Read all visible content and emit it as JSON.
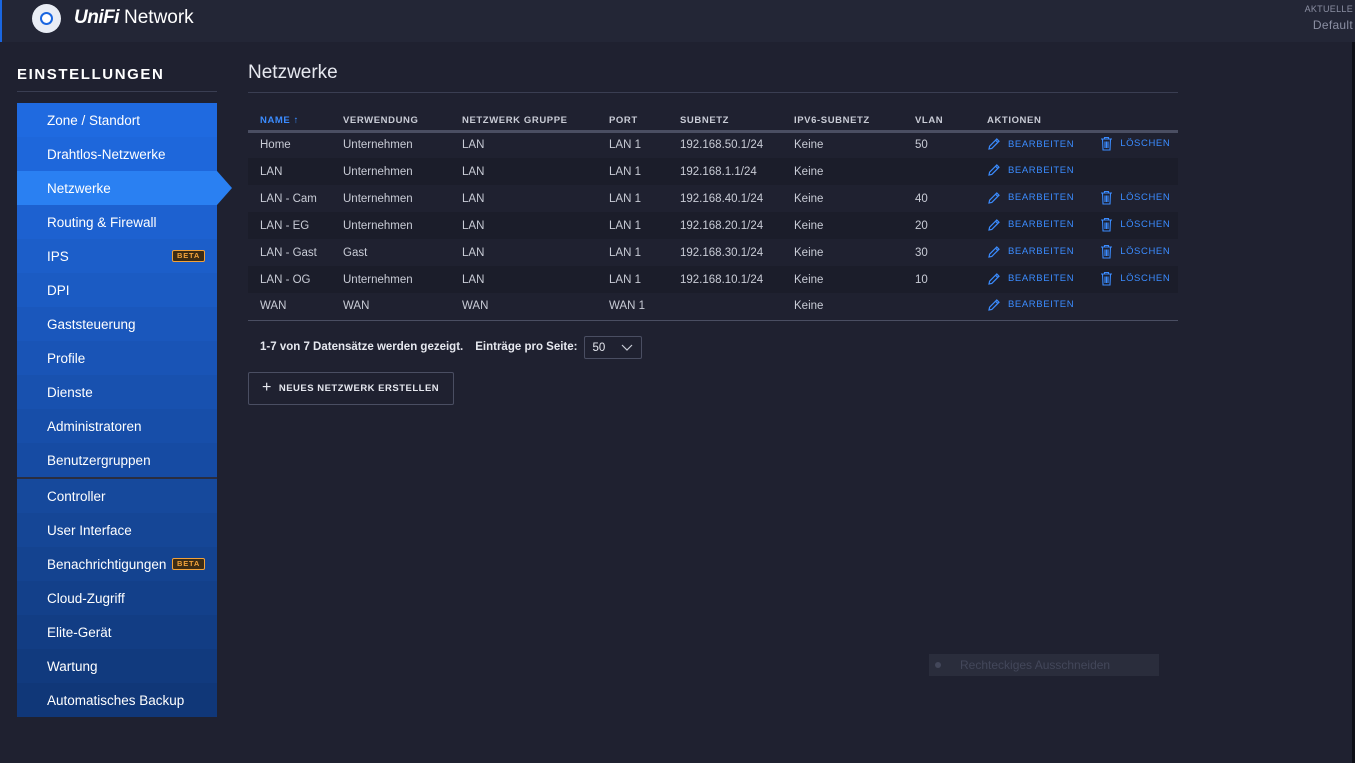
{
  "app": {
    "brand_strong": "UniFi",
    "brand_rest": "Network",
    "site_label": "AKTUELLE",
    "site_name": "Default"
  },
  "sidebar": {
    "title": "EINSTELLUNGEN",
    "items": [
      {
        "label": "Zone / Standort"
      },
      {
        "label": "Drahtlos-Netzwerke"
      },
      {
        "label": "Netzwerke",
        "active": true
      },
      {
        "label": "Routing & Firewall"
      },
      {
        "label": "IPS",
        "badge": "BETA"
      },
      {
        "label": "DPI"
      },
      {
        "label": "Gaststeuerung"
      },
      {
        "label": "Profile"
      },
      {
        "label": "Dienste"
      },
      {
        "label": "Administratoren"
      },
      {
        "label": "Benutzergruppen"
      },
      {
        "label": "Controller"
      },
      {
        "label": "User Interface"
      },
      {
        "label": "Benachrichtigungen",
        "badge": "BETA"
      },
      {
        "label": "Cloud-Zugriff"
      },
      {
        "label": "Elite-Gerät"
      },
      {
        "label": "Wartung"
      },
      {
        "label": "Automatisches Backup"
      }
    ],
    "colors": [
      "#1f6ae0",
      "#1e67db",
      "#2a80f2",
      "#1d61d0",
      "#1c5ec9",
      "#1b5bc3",
      "#1a57bc",
      "#1954b6",
      "#1851af",
      "#174ea9",
      "#164ba3",
      "#16499c",
      "#154696",
      "#144390",
      "#13408a",
      "#123d84",
      "#113a7e",
      "#103778"
    ]
  },
  "main": {
    "title": "Netzwerke",
    "columns": [
      "NAME ↑",
      "VERWENDUNG",
      "NETZWERK GRUPPE",
      "PORT",
      "SUBNETZ",
      "IPV6-SUBNETZ",
      "VLAN",
      "AKTIONEN"
    ],
    "edit_label": "BEARBEITEN",
    "delete_label": "LÖSCHEN",
    "rows": [
      {
        "name": "Home",
        "usage": "Unternehmen",
        "group": "LAN",
        "port": "LAN 1",
        "subnet": "192.168.50.1/24",
        "ipv6": "Keine",
        "vlan": "50",
        "deletable": true
      },
      {
        "name": "LAN",
        "usage": "Unternehmen",
        "group": "LAN",
        "port": "LAN 1",
        "subnet": "192.168.1.1/24",
        "ipv6": "Keine",
        "vlan": "",
        "deletable": false
      },
      {
        "name": "LAN - Cam",
        "usage": "Unternehmen",
        "group": "LAN",
        "port": "LAN 1",
        "subnet": "192.168.40.1/24",
        "ipv6": "Keine",
        "vlan": "40",
        "deletable": true
      },
      {
        "name": "LAN - EG",
        "usage": "Unternehmen",
        "group": "LAN",
        "port": "LAN 1",
        "subnet": "192.168.20.1/24",
        "ipv6": "Keine",
        "vlan": "20",
        "deletable": true
      },
      {
        "name": "LAN - Gast",
        "usage": "Gast",
        "group": "LAN",
        "port": "LAN 1",
        "subnet": "192.168.30.1/24",
        "ipv6": "Keine",
        "vlan": "30",
        "deletable": true
      },
      {
        "name": "LAN - OG",
        "usage": "Unternehmen",
        "group": "LAN",
        "port": "LAN 1",
        "subnet": "192.168.10.1/24",
        "ipv6": "Keine",
        "vlan": "10",
        "deletable": true
      },
      {
        "name": "WAN",
        "usage": "WAN",
        "group": "WAN",
        "port": "WAN 1",
        "subnet": "",
        "ipv6": "Keine",
        "vlan": "",
        "deletable": false
      }
    ],
    "pager": {
      "summary": "1-7 von 7 Datensätze werden gezeigt.",
      "per_page_label": "Einträge pro Seite:",
      "per_page_value": "50"
    },
    "new_button": "NEUES NETZWERK ERSTELLEN"
  },
  "overlay": {
    "ghost_text": "Rechteckiges Ausschneiden"
  }
}
